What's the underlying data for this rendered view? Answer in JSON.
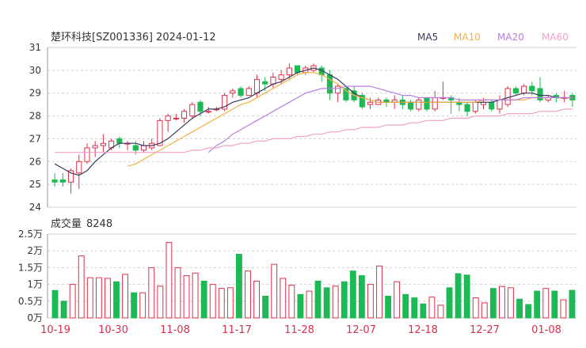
{
  "header": {
    "title": "楚环科技[SZ001336] 2024-01-12",
    "legend": [
      {
        "label": "MA5",
        "color": "#3a3a5c"
      },
      {
        "label": "MA10",
        "color": "#f5b041"
      },
      {
        "label": "MA20",
        "color": "#b57ee0"
      },
      {
        "label": "MA60",
        "color": "#f0a0c8"
      }
    ]
  },
  "volume_header": {
    "label": "成交量",
    "value": "8248"
  },
  "colors": {
    "up": "#e0304a",
    "down": "#1db954",
    "grid": "#cfcfcf",
    "axis_text": "#333333",
    "date_text": "#d6304a"
  },
  "chart_data": [
    {
      "type": "candlestick",
      "title": "楚环科技[SZ001336] 2024-01-12",
      "ylim": [
        24,
        31
      ],
      "yticks": [
        "24",
        "25",
        "26",
        "27",
        "28",
        "29",
        "30",
        "31"
      ],
      "series": [
        {
          "name": "K",
          "data": [
            [
              25.2,
              25.1,
              25.5,
              24.9
            ],
            [
              25.2,
              25.1,
              25.5,
              24.9
            ],
            [
              25.1,
              25.6,
              25.7,
              24.6
            ],
            [
              25.5,
              26.0,
              26.3,
              24.8
            ],
            [
              26.0,
              26.6,
              26.8,
              25.9
            ],
            [
              26.6,
              26.7,
              26.9,
              26.2
            ],
            [
              26.7,
              26.8,
              27.2,
              26.4
            ],
            [
              26.6,
              26.9,
              27.0,
              26.5
            ],
            [
              27.0,
              26.8,
              27.1,
              26.6
            ],
            [
              26.8,
              26.8,
              26.9,
              26.5
            ],
            [
              26.7,
              26.5,
              26.9,
              26.3
            ],
            [
              26.5,
              26.7,
              26.9,
              26.4
            ],
            [
              26.6,
              26.8,
              27.0,
              26.5
            ],
            [
              26.7,
              27.8,
              27.9,
              26.7
            ],
            [
              27.8,
              28.0,
              28.1,
              27.3
            ],
            [
              27.9,
              27.9,
              28.1,
              27.8
            ],
            [
              27.9,
              28.2,
              28.3,
              27.7
            ],
            [
              28.0,
              28.5,
              28.6,
              27.9
            ],
            [
              28.6,
              28.2,
              28.7,
              28.0
            ],
            [
              28.2,
              28.2,
              28.4,
              28.1
            ],
            [
              28.3,
              28.3,
              28.4,
              28.2
            ],
            [
              28.3,
              28.9,
              29.0,
              28.2
            ],
            [
              29.0,
              29.1,
              29.2,
              28.8
            ],
            [
              29.2,
              28.9,
              29.3,
              28.8
            ],
            [
              28.9,
              29.2,
              29.3,
              28.9
            ],
            [
              29.0,
              29.6,
              29.8,
              28.8
            ],
            [
              29.5,
              29.4,
              29.7,
              29.1
            ],
            [
              29.4,
              29.7,
              29.9,
              29.2
            ],
            [
              29.6,
              29.8,
              30.0,
              29.4
            ],
            [
              29.8,
              30.1,
              30.3,
              29.6
            ],
            [
              30.2,
              29.9,
              30.2,
              29.8
            ],
            [
              29.9,
              30.1,
              30.2,
              29.8
            ],
            [
              30.0,
              30.2,
              30.3,
              29.9
            ],
            [
              30.1,
              29.8,
              30.2,
              29.5
            ],
            [
              29.8,
              29.0,
              30.0,
              28.7
            ],
            [
              29.0,
              29.3,
              29.4,
              28.6
            ],
            [
              29.2,
              28.7,
              29.3,
              28.6
            ],
            [
              29.1,
              28.7,
              29.3,
              28.6
            ],
            [
              28.9,
              28.4,
              29.0,
              28.3
            ],
            [
              28.5,
              28.6,
              28.8,
              28.3
            ],
            [
              28.5,
              28.7,
              28.8,
              28.5
            ],
            [
              28.7,
              28.6,
              28.8,
              28.4
            ],
            [
              28.6,
              28.7,
              28.9,
              28.3
            ],
            [
              28.7,
              28.5,
              28.9,
              28.3
            ],
            [
              28.6,
              28.3,
              28.7,
              28.2
            ],
            [
              28.3,
              28.7,
              28.8,
              28.2
            ],
            [
              28.8,
              28.3,
              28.8,
              28.2
            ],
            [
              28.3,
              28.8,
              29.1,
              28.2
            ],
            [
              28.8,
              28.8,
              29.5,
              28.7
            ],
            [
              28.8,
              28.7,
              28.9,
              28.1
            ],
            [
              28.6,
              28.5,
              28.8,
              28.2
            ],
            [
              28.5,
              28.2,
              28.6,
              28.0
            ],
            [
              28.2,
              28.6,
              28.7,
              28.1
            ],
            [
              28.5,
              28.6,
              28.8,
              28.3
            ],
            [
              28.6,
              28.3,
              28.7,
              28.2
            ],
            [
              28.3,
              28.7,
              28.9,
              28.1
            ],
            [
              28.5,
              29.2,
              29.3,
              28.4
            ],
            [
              29.2,
              29.0,
              29.3,
              28.9
            ],
            [
              29.0,
              29.3,
              29.4,
              28.9
            ],
            [
              29.3,
              29.1,
              29.5,
              28.9
            ],
            [
              29.2,
              28.7,
              29.7,
              28.6
            ],
            [
              28.7,
              28.8,
              28.9,
              28.6
            ],
            [
              28.9,
              28.8,
              29.0,
              28.6
            ],
            [
              28.8,
              28.8,
              29.1,
              28.6
            ],
            [
              28.9,
              28.7,
              29.0,
              28.4
            ]
          ]
        },
        {
          "name": "MA5",
          "values": [
            25.9,
            25.7,
            25.5,
            25.4,
            25.6,
            26.0,
            26.3,
            26.6,
            26.8,
            26.8,
            26.8,
            26.7,
            26.7,
            26.8,
            27.0,
            27.3,
            27.6,
            27.9,
            28.1,
            28.3,
            28.3,
            28.4,
            28.6,
            28.7,
            28.8,
            29.0,
            29.2,
            29.4,
            29.5,
            29.7,
            29.9,
            30.0,
            30.1,
            30.0,
            29.8,
            29.6,
            29.3,
            29.0,
            28.8,
            28.7,
            28.6,
            28.6,
            28.6,
            28.6,
            28.6,
            28.6,
            28.6,
            28.6,
            28.6,
            28.6,
            28.6,
            28.6,
            28.6,
            28.6,
            28.6,
            28.7,
            28.8,
            28.9,
            29.0,
            29.0,
            28.9,
            28.9,
            28.8,
            28.8,
            28.8
          ]
        },
        {
          "name": "MA10",
          "values": [
            null,
            null,
            null,
            null,
            null,
            null,
            null,
            null,
            null,
            25.8,
            25.9,
            26.1,
            26.3,
            26.5,
            26.7,
            26.9,
            27.1,
            27.3,
            27.5,
            27.7,
            27.9,
            28.1,
            28.3,
            28.5,
            28.6,
            28.8,
            29.0,
            29.2,
            29.4,
            29.6,
            29.8,
            29.9,
            29.9,
            29.8,
            29.6,
            29.4,
            29.1,
            28.9,
            28.8,
            28.7,
            28.6,
            28.6,
            28.6,
            28.6,
            28.6,
            28.6,
            28.6,
            28.6,
            28.6,
            28.6,
            28.6,
            28.6,
            28.6,
            28.7,
            28.7,
            28.7,
            28.7,
            28.7,
            28.7,
            28.8,
            28.8,
            28.8,
            28.8,
            28.8,
            28.8
          ]
        },
        {
          "name": "MA20",
          "values": [
            null,
            null,
            null,
            null,
            null,
            null,
            null,
            null,
            null,
            null,
            null,
            null,
            null,
            null,
            null,
            null,
            null,
            null,
            null,
            26.4,
            26.7,
            26.9,
            27.2,
            27.4,
            27.6,
            27.8,
            28.0,
            28.2,
            28.4,
            28.6,
            28.8,
            29.0,
            29.1,
            29.2,
            29.2,
            29.2,
            29.3,
            29.3,
            29.3,
            29.3,
            29.2,
            29.1,
            29.0,
            28.9,
            28.9,
            28.8,
            28.8,
            28.8,
            28.8,
            28.8,
            28.7,
            28.7,
            28.7,
            28.7,
            28.7,
            28.7,
            28.7,
            28.7,
            28.8,
            28.8,
            28.8,
            28.8,
            28.8,
            28.8,
            28.8
          ]
        },
        {
          "name": "MA60",
          "values": [
            26.4,
            26.4,
            26.4,
            26.4,
            26.4,
            26.4,
            26.4,
            26.4,
            26.4,
            26.4,
            26.4,
            26.4,
            26.4,
            26.4,
            26.4,
            26.4,
            26.4,
            26.5,
            26.5,
            26.6,
            26.6,
            26.7,
            26.7,
            26.8,
            26.8,
            26.9,
            26.9,
            27.0,
            27.0,
            27.0,
            27.1,
            27.1,
            27.2,
            27.2,
            27.3,
            27.3,
            27.4,
            27.4,
            27.5,
            27.5,
            27.5,
            27.6,
            27.6,
            27.6,
            27.7,
            27.7,
            27.8,
            27.8,
            27.8,
            27.9,
            27.9,
            27.9,
            28.0,
            28.0,
            28.0,
            28.0,
            28.1,
            28.1,
            28.1,
            28.1,
            28.2,
            28.2,
            28.2,
            28.3,
            28.3
          ]
        }
      ]
    },
    {
      "type": "bar",
      "title": "成交量 8248",
      "ylim": [
        0,
        25000
      ],
      "yticks": [
        "0万",
        "0.5万",
        "1万",
        "1.5万",
        "2万",
        "2.5万"
      ],
      "xlabels": [
        "10-19",
        "10-30",
        "11-08",
        "11-17",
        "11-28",
        "12-07",
        "12-18",
        "12-27",
        "01-08"
      ],
      "series": [
        {
          "name": "成交量",
          "values": [
            8200,
            5000,
            10000,
            18500,
            12000,
            12000,
            11800,
            10800,
            13000,
            7500,
            7500,
            15000,
            9500,
            22500,
            15000,
            12600,
            13400,
            11000,
            10000,
            8800,
            9000,
            19000,
            14000,
            11000,
            6500,
            16000,
            11800,
            9800,
            7000,
            8000,
            11000,
            9000,
            9500,
            10800,
            14000,
            12600,
            10000,
            15500,
            6500,
            10800,
            7000,
            6000,
            4200,
            6200,
            3800,
            9000,
            13200,
            12800,
            6000,
            4500,
            8800,
            9400,
            9000,
            5600,
            4000,
            8000,
            8800,
            8000,
            5400,
            8248
          ]
        }
      ]
    }
  ]
}
